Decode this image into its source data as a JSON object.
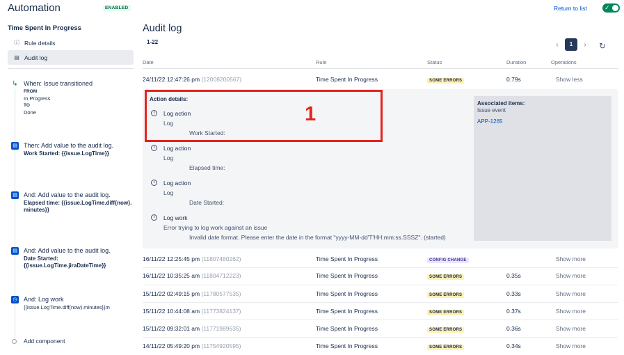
{
  "header": {
    "app_title": "Automation",
    "enabled_badge": "ENABLED",
    "return_link": "Return to list",
    "toggle_check": "✓"
  },
  "sidebar": {
    "rule_name": "Time Spent In Progress",
    "nav": [
      {
        "icon": "ⓘ",
        "label": "Rule details"
      },
      {
        "icon": "▤",
        "label": "Audit log"
      }
    ],
    "components": [
      {
        "kind": "trigger",
        "icon": "↳",
        "title": "When: Issue transitioned",
        "from_label": "FROM",
        "from_value": "In Progress",
        "to_label": "TO",
        "to_value": "Done"
      },
      {
        "kind": "action",
        "icon": "▤",
        "title": "Then: Add value to the audit log.",
        "detail": "Work Started: {{issue.LogTime}}"
      },
      {
        "kind": "action",
        "icon": "▤",
        "title": "And: Add value to the audit log.",
        "detail": "Elapsed time: {{issue.LogTime.diff{now}.minutes}}"
      },
      {
        "kind": "action",
        "icon": "▤",
        "title": "And: Add value to the audit log.",
        "detail": "Date Started: {{issue.LogTime.jiraDateTime}}"
      },
      {
        "kind": "action",
        "icon": "◷",
        "title": "And: Log work",
        "detail": "{{issue.LogTime.diff(now).minutes}}m"
      }
    ],
    "add_component": "Add component"
  },
  "main": {
    "title": "Audit log",
    "range": "1-22",
    "pager": {
      "prev": "‹",
      "page": "1",
      "next": "›",
      "refresh": "↻"
    },
    "columns": [
      "Date",
      "Rule",
      "Status",
      "Duration",
      "Operations"
    ],
    "rows": [
      {
        "date": "24/11/22 12:47:26 pm",
        "id": "(12008200567)",
        "rule": "Time Spent In Progress",
        "status": "SOME ERRORS",
        "duration": "0.79s",
        "op": "Show less"
      },
      {
        "date": "16/11/22 12:25:45 pm",
        "id": "(11807480262)",
        "rule": "Time Spent In Progress",
        "status": "CONFIG CHANGE",
        "duration": "",
        "op": "Show more"
      },
      {
        "date": "16/11/22 10:35:25 am",
        "id": "(11804712223)",
        "rule": "Time Spent In Progress",
        "status": "SOME ERRORS",
        "duration": "0.35s",
        "op": "Show more"
      },
      {
        "date": "15/11/22 02:49:15 pm",
        "id": "(11780577535)",
        "rule": "Time Spent In Progress",
        "status": "SOME ERRORS",
        "duration": "0.33s",
        "op": "Show more"
      },
      {
        "date": "15/11/22 10:44:08 am",
        "id": "(11773824137)",
        "rule": "Time Spent In Progress",
        "status": "SOME ERRORS",
        "duration": "0.37s",
        "op": "Show more"
      },
      {
        "date": "15/11/22 09:32:01 am",
        "id": "(11771989635)",
        "rule": "Time Spent In Progress",
        "status": "SOME ERRORS",
        "duration": "0.36s",
        "op": "Show more"
      },
      {
        "date": "14/11/22 05:49:20 pm",
        "id": "(11754920595)",
        "rule": "Time Spent In Progress",
        "status": "SOME ERRORS",
        "duration": "0.34s",
        "op": "Show more"
      }
    ],
    "details": {
      "title": "Action details:",
      "entries": [
        {
          "icon": "i",
          "title": "Log action",
          "sub": "Log",
          "msg": "Work Started:"
        },
        {
          "icon": "i",
          "title": "Log action",
          "sub": "Log",
          "msg": "Elapsed time:"
        },
        {
          "icon": "i",
          "title": "Log action",
          "sub": "Log",
          "msg": "Date Started:"
        },
        {
          "icon": "i",
          "title": "Log work",
          "sub": "Error trying to log work against an issue",
          "msg": "Invalid date format. Please enter the date in the format \"yyyy-MM-dd'T'HH:mm:ss.SSSZ\". (started)"
        }
      ],
      "associated": {
        "title": "Associated items:",
        "subtitle": "Issue event",
        "key": "APP-1265"
      }
    },
    "annotation_number": "1"
  },
  "colors": {
    "accent": "#0052cc",
    "enabled": "#00875a",
    "highlight": "#e5231e",
    "error_badge": "#fff0b3",
    "config_badge": "#eae6ff"
  }
}
